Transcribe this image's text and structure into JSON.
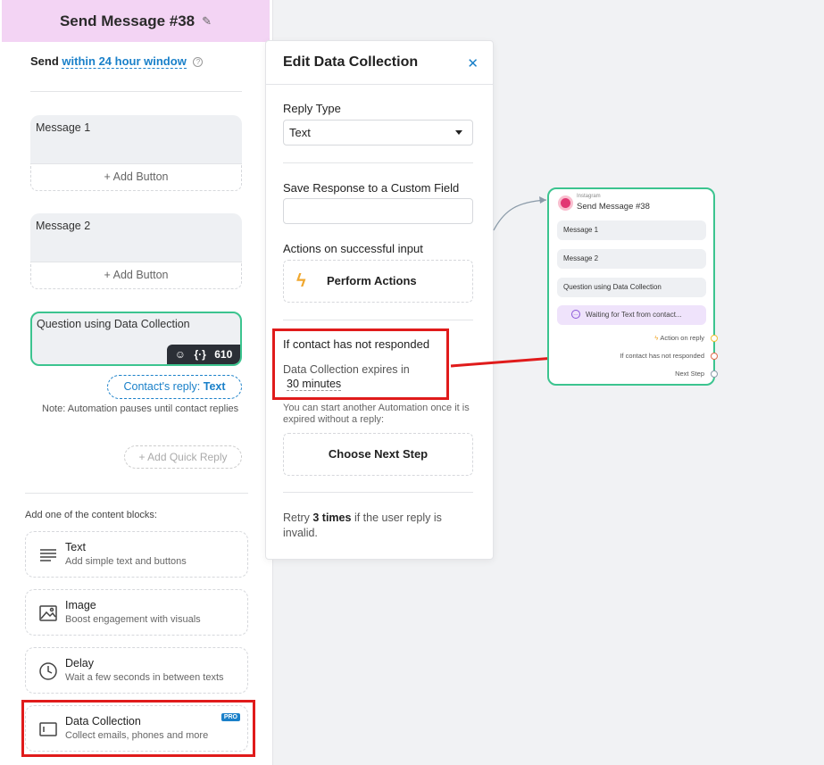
{
  "left_panel": {
    "title": "Send Message #38",
    "send_prefix": "Send",
    "send_window": "within 24 hour window",
    "messages": [
      {
        "label": "Message 1",
        "add_button": "+ Add Button"
      },
      {
        "label": "Message 2",
        "add_button": "+ Add Button"
      }
    ],
    "data_collection": {
      "label": "Question using Data Collection",
      "tool_braces": "{·}",
      "count": "610"
    },
    "reply_pill": {
      "prefix": "Contact's reply:",
      "value": "Text"
    },
    "note": "Note: Automation pauses until contact replies",
    "quick_reply": "+ Add Quick Reply",
    "add_blocks_label": "Add one of the content blocks:",
    "blocks": [
      {
        "title": "Text",
        "subtitle": "Add simple text and buttons",
        "icon": "text-lines-icon"
      },
      {
        "title": "Image",
        "subtitle": "Boost engagement with visuals",
        "icon": "image-icon"
      },
      {
        "title": "Delay",
        "subtitle": "Wait a few seconds in between texts",
        "icon": "clock-icon"
      },
      {
        "title": "Data Collection",
        "subtitle": "Collect emails, phones and more",
        "icon": "input-box-icon",
        "badge": "PRO"
      }
    ]
  },
  "edit_panel": {
    "title": "Edit Data Collection",
    "reply_type_label": "Reply Type",
    "reply_type_value": "Text",
    "save_response_label": "Save Response to a Custom Field",
    "save_response_value": "",
    "actions_label": "Actions on successful input",
    "perform_actions": "Perform Actions",
    "not_responded_label": "If contact has not responded",
    "expires_label": "Data Collection expires in",
    "expires_value": "30 minutes",
    "hint": "You can start another Automation once it is expired without a reply:",
    "choose_next": "Choose Next Step",
    "retry_prefix": "Retry",
    "retry_value": "3 times",
    "retry_suffix": "if the user reply is invalid."
  },
  "node": {
    "platform": "Instagram",
    "title": "Send Message #38",
    "items": [
      "Message 1",
      "Message 2",
      "Question using Data Collection"
    ],
    "waiting": "Waiting for Text from contact...",
    "action_on_reply": "Action on reply",
    "not_responded": "If contact has not responded",
    "next_step": "Next Step"
  },
  "colors": {
    "accent_blue": "#1a80c9",
    "highlight_red": "#e01b1b",
    "node_border_green": "#3cc48f",
    "header_pink": "#f3d4f4"
  }
}
